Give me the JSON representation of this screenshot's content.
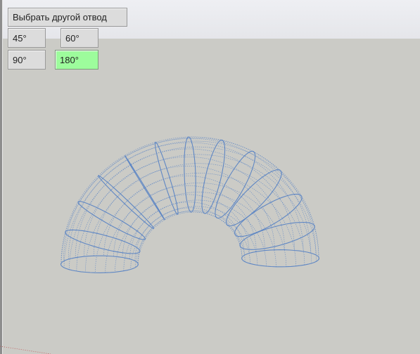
{
  "toolbar": {
    "switch_label": "Выбрать другой отвод",
    "angles": [
      "45°",
      "60°",
      "90°",
      "180°"
    ],
    "selected_angle": "180°"
  },
  "model": {
    "description_icon": "pipe-bend-wireframe",
    "stroke_color": "#5f87c4"
  }
}
